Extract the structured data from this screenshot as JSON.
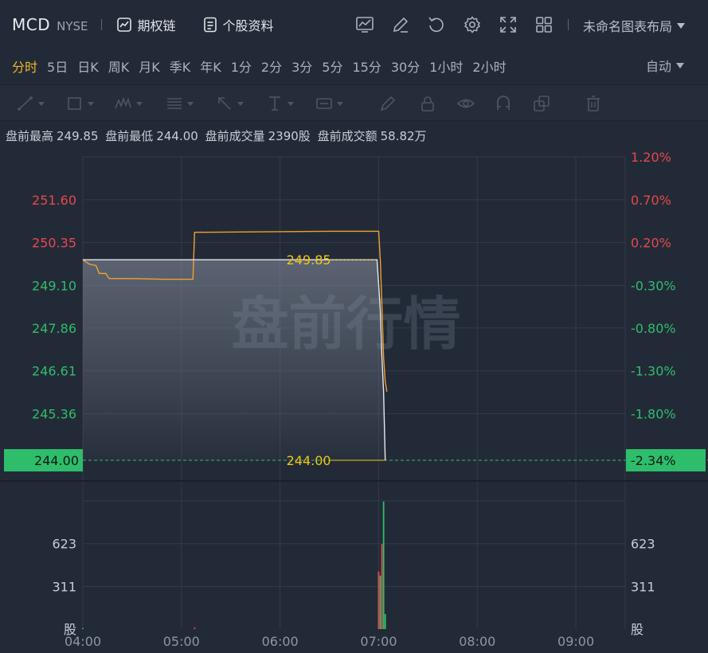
{
  "header": {
    "ticker": "MCD",
    "exchange": "NYSE",
    "links": [
      {
        "label": "期权链",
        "icon": "option-chain-icon"
      },
      {
        "label": "个股资料",
        "icon": "document-icon"
      }
    ],
    "tools": [
      "indicator-icon",
      "edit-icon",
      "refresh-icon",
      "settings-icon",
      "fullscreen-icon",
      "grid-layout-icon"
    ],
    "layout_name": "未命名图表布局"
  },
  "periods": {
    "items": [
      "分时",
      "5日",
      "日K",
      "周K",
      "月K",
      "季K",
      "年K",
      "1分",
      "2分",
      "3分",
      "5分",
      "15分",
      "30分",
      "1小时",
      "2小时"
    ],
    "active_index": 0,
    "auto_label": "自动"
  },
  "draw_tools": [
    "line-tool-icon",
    "rectangle-tool-icon",
    "wave-tool-icon",
    "fib-tool-icon",
    "arrow-tool-icon",
    "text-marker-icon",
    "label-tool-icon",
    "brush-icon",
    "lock-icon",
    "eye-icon",
    "magnet-icon",
    "copy-icon",
    "trash-icon"
  ],
  "stats": {
    "high_label": "盘前最高",
    "high_value": "249.85",
    "low_label": "盘前最低",
    "low_value": "244.00",
    "volume_label": "盘前成交量",
    "volume_value": "2390股",
    "amount_label": "盘前成交额",
    "amount_value": "58.82万"
  },
  "colors": {
    "up": "#e5484d",
    "down": "#2ebd6b",
    "price_line": "#e6e9ee",
    "avg_line": "#f0a030",
    "marker_text": "#f0c419",
    "background": "#232a37",
    "grid": "#323a48"
  },
  "chart_data": {
    "type": "line",
    "watermark": "盘前行情",
    "prev_close": 249.85,
    "price_ylim": [
      244.0,
      252.85
    ],
    "price_ticks": [
      252.85,
      251.6,
      250.35,
      249.1,
      247.86,
      246.61,
      245.36,
      244.0
    ],
    "price_tick_labels": [
      "",
      "251.60",
      "250.35",
      "249.10",
      "247.86",
      "246.61",
      "245.36",
      "244.00"
    ],
    "percent_tick_labels": [
      "1.20%",
      "0.70%",
      "0.20%",
      "-0.30%",
      "-0.80%",
      "-1.30%",
      "-1.80%",
      "-2.34%"
    ],
    "x_tick_labels": [
      "04:00",
      "05:00",
      "06:00",
      "07:00",
      "08:00",
      "09:00"
    ],
    "x_range_minutes": [
      0,
      330
    ],
    "high_marker": {
      "value": 249.85,
      "label": "249.85"
    },
    "low_marker": {
      "value": 244.0,
      "label": "244.00"
    },
    "series": [
      {
        "role": "price",
        "points": [
          [
            0,
            249.85
          ],
          [
            84,
            249.85
          ],
          [
            90,
            249.85
          ],
          [
            179,
            249.85
          ],
          [
            181,
            248.4
          ],
          [
            182,
            247.0
          ],
          [
            183,
            246.0
          ],
          [
            184,
            244.0
          ]
        ]
      },
      {
        "role": "average",
        "points": [
          [
            0,
            249.85
          ],
          [
            4,
            249.72
          ],
          [
            8,
            249.68
          ],
          [
            10,
            249.45
          ],
          [
            14,
            249.45
          ],
          [
            16,
            249.3
          ],
          [
            30,
            249.3
          ],
          [
            50,
            249.28
          ],
          [
            67,
            249.28
          ],
          [
            68,
            250.65
          ],
          [
            150,
            250.68
          ],
          [
            180,
            250.68
          ],
          [
            181,
            249.85
          ],
          [
            182,
            248.5
          ],
          [
            183,
            247.0
          ],
          [
            184,
            246.3
          ],
          [
            185,
            246.0
          ]
        ]
      }
    ],
    "volume": {
      "ylim": [
        0,
        935
      ],
      "ticks": [
        623,
        311
      ],
      "tick_labels": [
        "623",
        "311"
      ],
      "unit_label": "股",
      "bars": [
        {
          "t": 0,
          "v": 8,
          "dir": "down"
        },
        {
          "t": 68,
          "v": 12,
          "dir": "up"
        },
        {
          "t": 180,
          "v": 420,
          "dir": "up"
        },
        {
          "t": 181,
          "v": 390,
          "dir": "down"
        },
        {
          "t": 182,
          "v": 620,
          "dir": "up"
        },
        {
          "t": 183,
          "v": 930,
          "dir": "down"
        },
        {
          "t": 184,
          "v": 110,
          "dir": "down"
        }
      ]
    }
  }
}
